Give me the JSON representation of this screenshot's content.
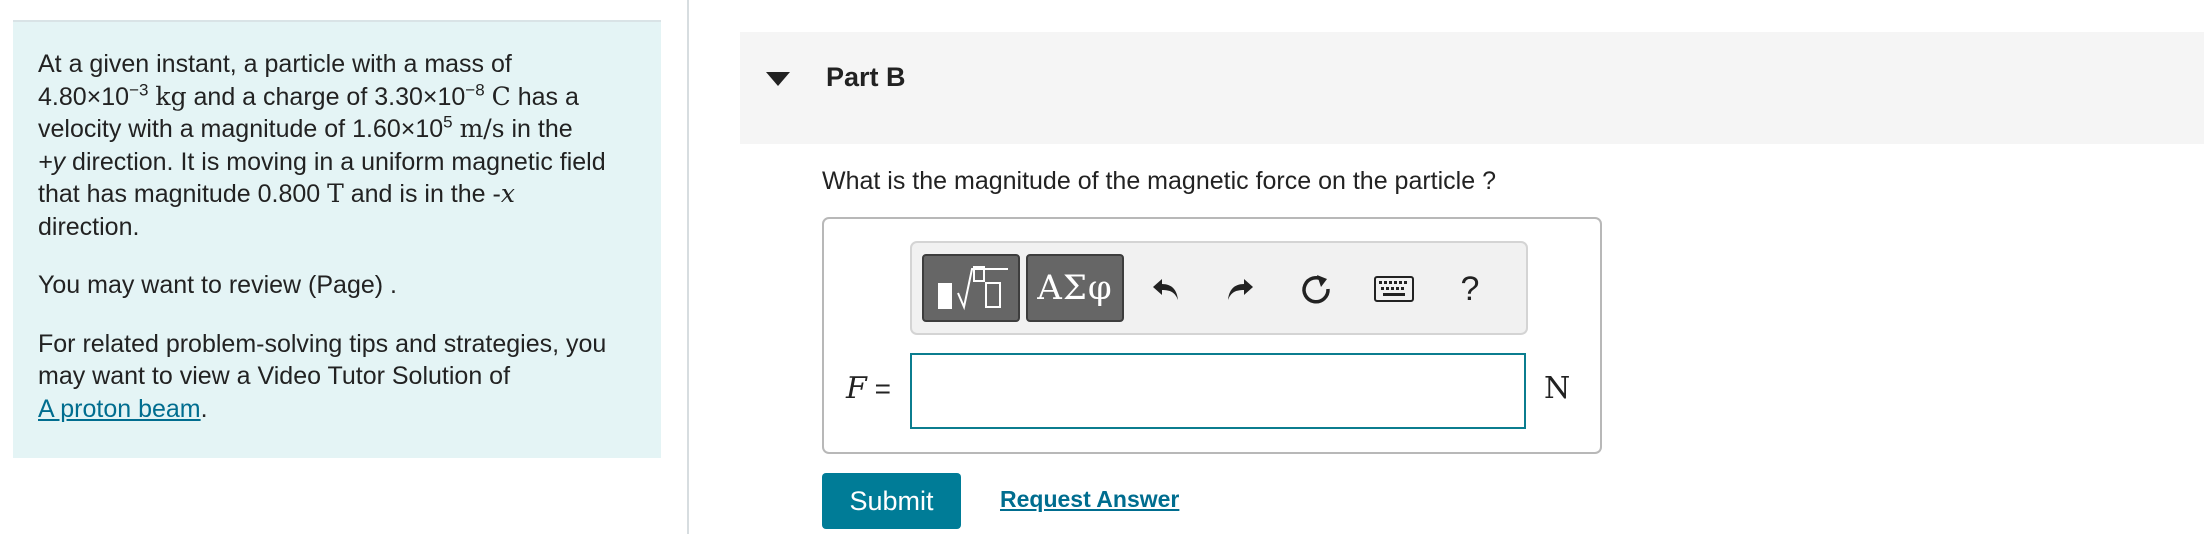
{
  "problem": {
    "line1": "At a given instant, a particle with a mass of",
    "mass_mantissa": "4.80×10",
    "mass_exp": "−3",
    "mass_unit": "kg",
    "and_charge": " and a charge of ",
    "charge_mantissa": "3.30×10",
    "charge_exp": "−8",
    "charge_unit": "C",
    "has_a": " has a",
    "velocity_text": "velocity with a magnitude of ",
    "vel_mantissa": "1.60×10",
    "vel_exp": "5",
    "vel_unit": "m/s",
    "in_the": " in the",
    "dir_y": "+y",
    "moving_text": " direction. It is moving in a uniform magnetic field",
    "field_text": "that has magnitude ",
    "field_value": "0.800",
    "field_unit": "T",
    "field_dir_text": " and is in the -",
    "dir_x": "x",
    "direction_word": "direction.",
    "review_text": "You may want to review (Page) .",
    "related_text": "For related problem-solving tips and strategies, you may want to view a Video Tutor Solution of",
    "video_link": "A proton beam",
    "period": "."
  },
  "part": {
    "title": "Part B"
  },
  "question": "What is the magnitude of the magnetic force on the particle ?",
  "toolbar": {
    "templates_icon": "templates-icon",
    "greek_label": "ΑΣφ",
    "undo_icon": "undo-icon",
    "redo_icon": "redo-icon",
    "reset_icon": "reset-icon",
    "keyboard_icon": "keyboard-icon",
    "help_label": "?"
  },
  "answer": {
    "variable": "F",
    "equals": " =",
    "value": "",
    "unit": "N"
  },
  "actions": {
    "submit_label": "Submit",
    "request_label": "Request Answer"
  },
  "colors": {
    "accent": "#007c97",
    "panel_bg": "#e4f4f5",
    "input_border": "#0b7d8f"
  }
}
